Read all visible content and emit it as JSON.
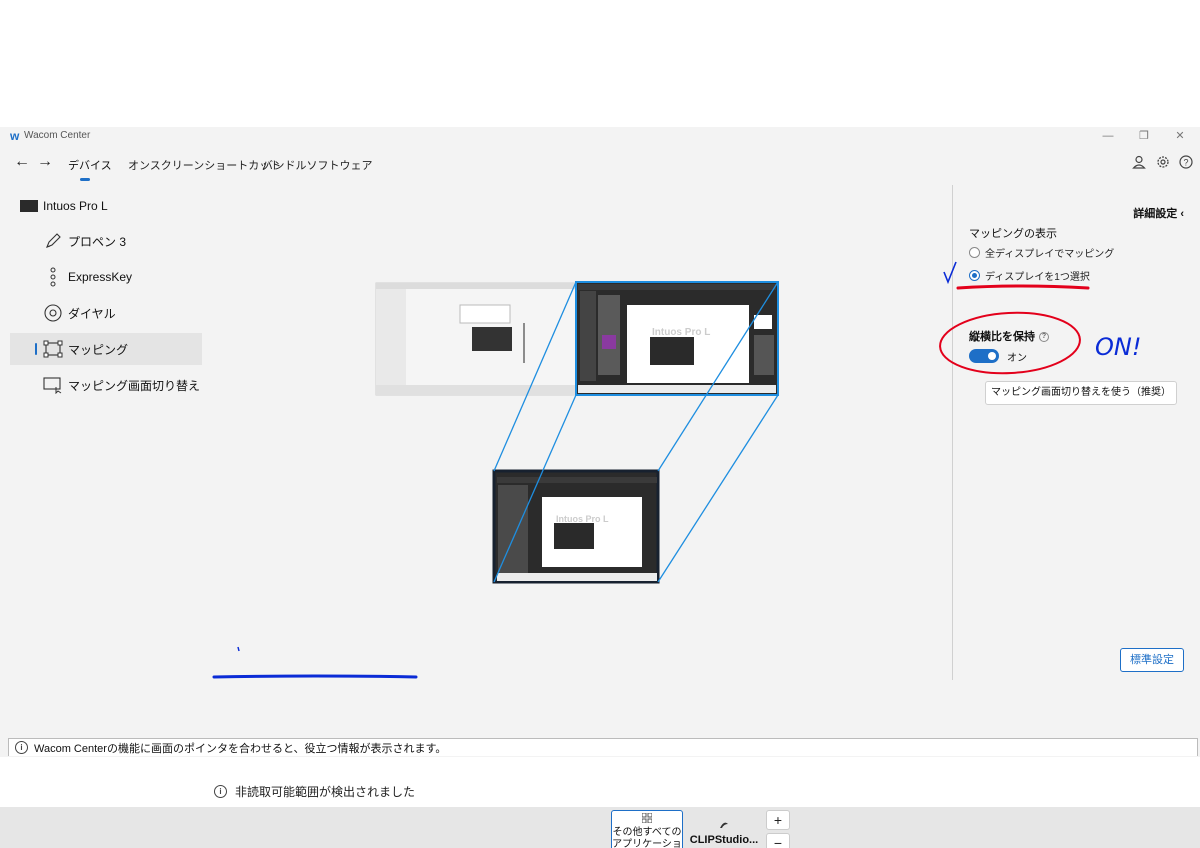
{
  "window": {
    "title": "Wacom Center",
    "logo": "w"
  },
  "nav": {
    "tabs": [
      "デバイス",
      "オンスクリーンショートカット",
      "バンドルソフトウェア"
    ],
    "active_tab": "デバイス"
  },
  "sidebar": {
    "device_name": "Intuos Pro L",
    "items": [
      {
        "label": "プロペン 3",
        "icon": "pen-icon"
      },
      {
        "label": "ExpressKey",
        "icon": "expresskey-icon"
      },
      {
        "label": "ダイヤル",
        "icon": "dial-icon"
      },
      {
        "label": "マッピング",
        "icon": "mapping-icon",
        "active": true
      },
      {
        "label": "マッピング画面切り替え",
        "icon": "display-toggle-icon"
      }
    ]
  },
  "right_panel": {
    "advanced_label": "詳細設定",
    "mapping_section_title": "マッピングの表示",
    "radio_options": [
      {
        "label": "全ディスプレイでマッピング",
        "selected": false
      },
      {
        "label": "ディスプレイを1つ選択",
        "selected": true
      }
    ],
    "aspect_title": "縦横比を保持",
    "aspect_state": "オン",
    "aspect_on": true,
    "switch_button": "マッピング画面切り替えを使う（推奨）",
    "default_button": "標準設定"
  },
  "preview": {
    "tablet_text": "Intuos Pro L"
  },
  "notice": "非読取可能範囲が検出されました",
  "apps": {
    "all_apps_label_1": "その他すべての",
    "all_apps_label_2": "アプリケーション",
    "clip_label": "CLIPStudio...",
    "add": "+",
    "remove": "−"
  },
  "status_bar": "Wacom Centerの機能に画面のポインタを合わせると、役立つ情報が表示されます。",
  "annotation": {
    "handwritten": "ON!"
  },
  "colors": {
    "accent": "#1e6fc7",
    "annotation_red": "#e3001b",
    "annotation_blue": "#0a2bd6"
  }
}
